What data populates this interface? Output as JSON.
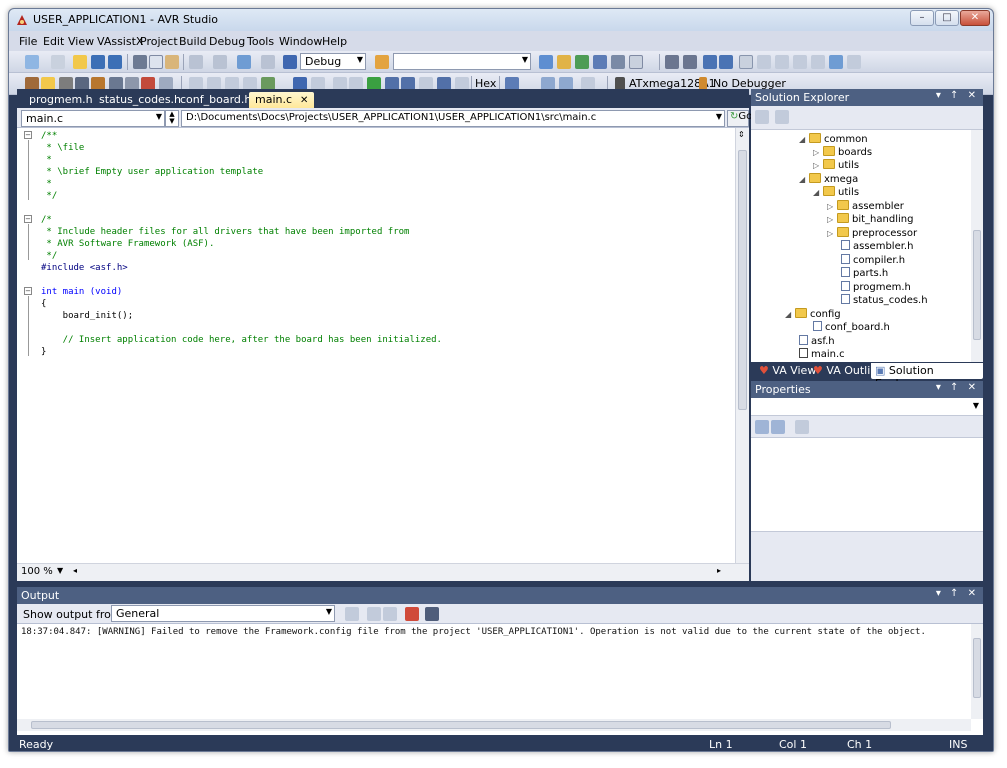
{
  "window": {
    "title": "USER_APPLICATION1 - AVR Studio",
    "minimize": "–",
    "maximize": "□",
    "close": "✕"
  },
  "menu": [
    "File",
    "Edit",
    "View",
    "VAssistX",
    "Project",
    "Build",
    "Debug",
    "Tools",
    "Window",
    "Help"
  ],
  "toolbar": {
    "config": "Debug",
    "search_value": "",
    "hex_label": "Hex",
    "device": "ATxmega128A1",
    "debugger": "No Debugger"
  },
  "tabs": [
    {
      "label": "progmem.h",
      "active": false
    },
    {
      "label": "status_codes.h",
      "active": false
    },
    {
      "label": "conf_board.h",
      "active": false
    },
    {
      "label": "main.c",
      "active": true,
      "close": "✕"
    }
  ],
  "nav": {
    "file_combo": "main.c",
    "path": "D:\\Documents\\Docs\\Projects\\USER_APPLICATION1\\USER_APPLICATION1\\src\\main.c",
    "go": "Go"
  },
  "code": [
    "/**",
    " * \\file",
    " *",
    " * \\brief Empty user application template",
    " *",
    " */",
    "",
    "/*",
    " * Include header files for all drivers that have been imported from",
    " * AVR Software Framework (ASF).",
    " */",
    "#include <asf.h>",
    "",
    "int main (void)",
    "{",
    "    board_init();",
    "",
    "    // Insert application code here, after the board has been initialized.",
    "}"
  ],
  "zoom": "100 %",
  "solution_explorer": {
    "title": "Solution Explorer",
    "tree": [
      {
        "label": "common",
        "type": "folder",
        "expand": "◢"
      },
      {
        "label": "boards",
        "type": "folder",
        "expand": "▷"
      },
      {
        "label": "utils",
        "type": "folder",
        "expand": "▷"
      },
      {
        "label": "xmega",
        "type": "folder",
        "expand": "◢"
      },
      {
        "label": "utils",
        "type": "folder",
        "expand": "◢"
      },
      {
        "label": "assembler",
        "type": "folder",
        "expand": "▷"
      },
      {
        "label": "bit_handling",
        "type": "folder",
        "expand": "▷"
      },
      {
        "label": "preprocessor",
        "type": "folder",
        "expand": "▷"
      },
      {
        "label": "assembler.h",
        "type": "h",
        "expand": ""
      },
      {
        "label": "compiler.h",
        "type": "h",
        "expand": ""
      },
      {
        "label": "parts.h",
        "type": "h",
        "expand": ""
      },
      {
        "label": "progmem.h",
        "type": "h",
        "expand": ""
      },
      {
        "label": "status_codes.h",
        "type": "h",
        "expand": ""
      },
      {
        "label": "config",
        "type": "folder",
        "expand": "◢"
      },
      {
        "label": "conf_board.h",
        "type": "h",
        "expand": ""
      },
      {
        "label": "asf.h",
        "type": "h",
        "expand": ""
      },
      {
        "label": "main.c",
        "type": "c",
        "expand": ""
      }
    ],
    "tabs": [
      "VA View",
      "VA Outline",
      "Solution Explorer"
    ]
  },
  "properties": {
    "title": "Properties"
  },
  "output": {
    "title": "Output",
    "show_from_label": "Show output from:",
    "source": "General",
    "text": "18:37:04.847: [WARNING] Failed to remove the Framework.config file from the project 'USER_APPLICATION1'. Operation is not valid due to the current state of the object."
  },
  "status": {
    "left": "Ready",
    "ln": "Ln 1",
    "col": "Col 1",
    "ch": "Ch 1",
    "mode": "INS"
  },
  "pane_controls": "▾ ↑ ✕"
}
